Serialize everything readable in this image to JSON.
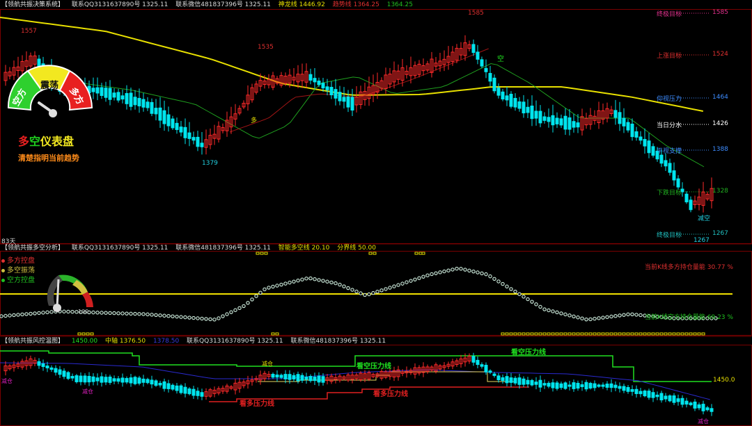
{
  "panel1": {
    "title": "【领航共振决策系统】",
    "items": [
      "联系QQ3131637890号 1325.11",
      "联系微信481837396号 1325.11",
      "神龙线 1446.92",
      "趋势线 1364.25",
      "1364.25"
    ],
    "days": "83天",
    "price_labels": [
      "1557",
      "1535",
      "1379",
      "1585",
      "1267"
    ],
    "signal_labels": [
      "多",
      "空",
      "减空"
    ],
    "right_labels": [
      {
        "name": "终极目标",
        "value": "1585",
        "color": "#e0308c"
      },
      {
        "name": "上涨目标",
        "value": "1524",
        "color": "#e03030"
      },
      {
        "name": "仰视压力",
        "value": "1464",
        "color": "#3d8cff"
      },
      {
        "name": "当日分水",
        "value": "1426",
        "color": "#ffffff"
      },
      {
        "name": "平视支撑",
        "value": "1388",
        "color": "#3d8cff"
      },
      {
        "name": "下跌目标",
        "value": "1328",
        "color": "#20b020"
      },
      {
        "name": "终极目标",
        "value": "1267",
        "color": "#20c0c0"
      }
    ],
    "promo": {
      "title_parts": [
        "多",
        "空",
        "仪表盘"
      ],
      "subtitle": "清楚指明当前趋势"
    },
    "gauge": {
      "left": "空方",
      "mid": "震荡",
      "right": "多方"
    }
  },
  "panel2": {
    "title": "【领航共振多空分析】",
    "items": [
      "联系QQ3131637890号 1325.11",
      "联系微信481837396号 1325.11",
      "智能多空线 20.10",
      "分界线 50.00"
    ],
    "legend": [
      {
        "label": "多方控盘",
        "color": "#e03030"
      },
      {
        "label": "多空振荡",
        "color": "#d0c040"
      },
      {
        "label": "空方控盘",
        "color": "#20c020"
      }
    ],
    "gauge_max": "100",
    "right1": "当前K线多方持仓量能  30.77 %",
    "right2": "当前K线空方持仓量能  69.23 %"
  },
  "panel3": {
    "title": "【领航共振风控温图】",
    "items": [
      "1450.00",
      "中轴 1376.50",
      "1378.50",
      "联系QQ3131637890号 1325.11",
      "联系微信481837396号 1325.11"
    ],
    "labels": [
      "看空压力线",
      "看空压力线",
      "看多压力线",
      "看多压力线",
      "减仓",
      "减仓",
      "减仓",
      "减仓"
    ],
    "level": "1450.0"
  },
  "colors": {
    "up": "#ff2a2a",
    "down": "#00e5ee",
    "ma_yellow": "#e8e000",
    "ma_green": "#1fa01f"
  }
}
